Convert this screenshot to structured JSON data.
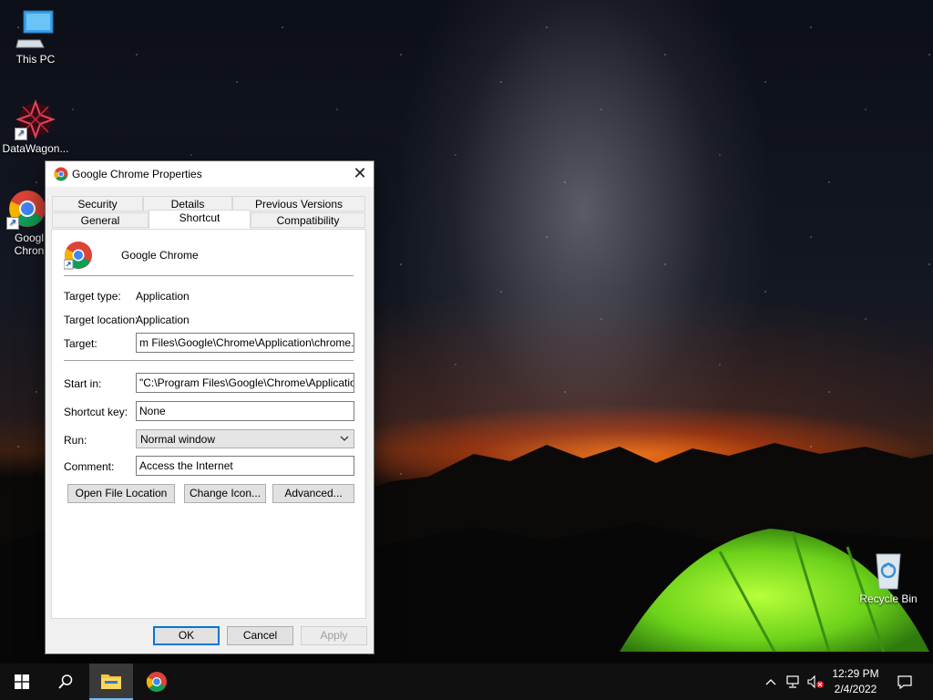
{
  "desktop": {
    "icons": [
      {
        "label": "This PC"
      },
      {
        "label": "DataWagon..."
      },
      {
        "label": "Googl Chron"
      },
      {
        "label": "Recycle Bin"
      }
    ]
  },
  "dialog": {
    "title": "Google Chrome Properties",
    "close_glyph": "✕",
    "tabs_top": [
      "Security",
      "Details",
      "Previous Versions"
    ],
    "tabs_bottom": [
      "General",
      "Shortcut",
      "Compatibility"
    ],
    "active_tab": "Shortcut",
    "app_name": "Google Chrome",
    "fields": {
      "target_type_label": "Target type:",
      "target_type_value": "Application",
      "target_location_label": "Target location:",
      "target_location_value": "Application",
      "target_label": "Target:",
      "target_value": "m Files\\Google\\Chrome\\Application\\chrome.exe\"",
      "start_in_label": "Start in:",
      "start_in_value": "\"C:\\Program Files\\Google\\Chrome\\Application\"",
      "shortcut_key_label": "Shortcut key:",
      "shortcut_key_value": "None",
      "run_label": "Run:",
      "run_value": "Normal window",
      "comment_label": "Comment:",
      "comment_value": "Access the Internet"
    },
    "buttons": {
      "open_file_location": "Open File Location",
      "change_icon": "Change Icon...",
      "advanced": "Advanced...",
      "ok": "OK",
      "cancel": "Cancel",
      "apply": "Apply"
    }
  },
  "taskbar": {
    "time": "12:29 PM",
    "date": "2/4/2022",
    "accent": "#76b9ed"
  }
}
